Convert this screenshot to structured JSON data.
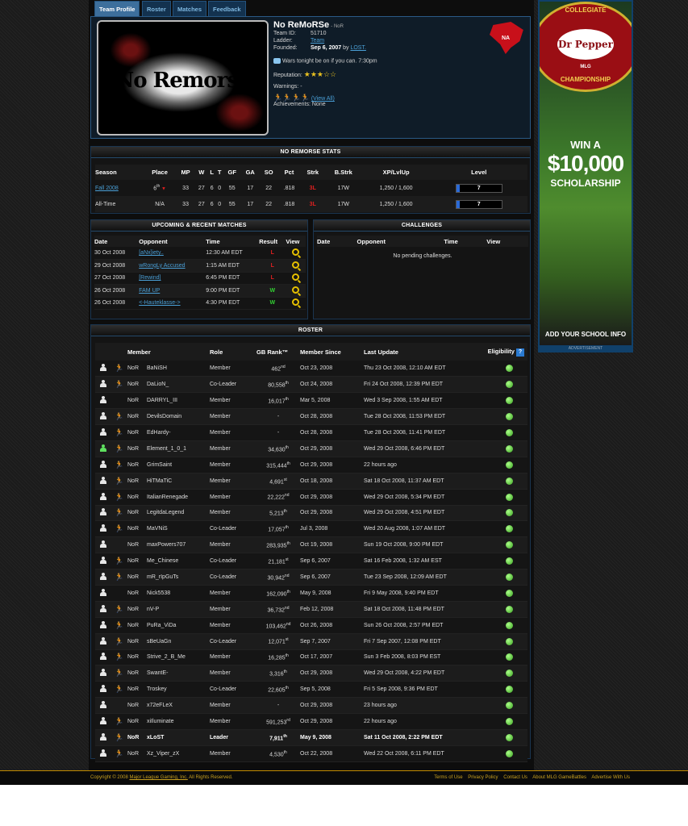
{
  "tabs": {
    "team_profile": "Team Profile",
    "roster": "Roster",
    "matches": "Matches",
    "feedback": "Feedback"
  },
  "team": {
    "name": "No ReMoRSe",
    "tag_suffix": "- NoR",
    "logo_text": "No Remorse",
    "team_id_label": "Team ID:",
    "team_id": "51710",
    "ladder_label": "Ladder:",
    "ladder": "Team",
    "founded_label": "Founded:",
    "founded": "Sep 6, 2007",
    "founded_by": "by",
    "founder": "LOST.",
    "message": "Wars tonight be on if you can. 7:30pm",
    "reputation_label": "Reputation:",
    "reputation_stars": 3.5,
    "warnings_label": "Warnings:",
    "warnings": "-",
    "view_all": "(View All)",
    "achievements_label": "Achievements:",
    "achievements": "None",
    "region": "NA"
  },
  "stats": {
    "title": "NO REMORSE STATS",
    "headers": [
      "Season",
      "Place",
      "MP",
      "W",
      "L",
      "T",
      "GF",
      "GA",
      "SO",
      "Pct",
      "Strk",
      "B.Strk",
      "XP/LvlUp",
      "Level"
    ],
    "rows": [
      {
        "season": "Fall 2008",
        "place": "6",
        "place_sup": "th",
        "mp": "33",
        "w": "27",
        "l": "6",
        "t": "0",
        "gf": "55",
        "ga": "17",
        "so": "22",
        "pct": ".818",
        "strk": "3L",
        "bstrk": "17W",
        "xp": "1,250 / 1,600",
        "level": "7",
        "level_fraction": 0.08
      },
      {
        "season": "All-Time",
        "place": "N/A",
        "place_sup": "",
        "mp": "33",
        "w": "27",
        "l": "6",
        "t": "0",
        "gf": "55",
        "ga": "17",
        "so": "22",
        "pct": ".818",
        "strk": "3L",
        "bstrk": "17W",
        "xp": "1,250 / 1,600",
        "level": "7",
        "level_fraction": 0.08
      }
    ]
  },
  "matches": {
    "title": "UPCOMING & RECENT MATCHES",
    "headers": [
      "Date",
      "Opponent",
      "Time",
      "Result",
      "View"
    ],
    "rows": [
      {
        "date": "30 Oct 2008",
        "opponent": "[aNx]iety..",
        "time": "12:30 AM EDT",
        "result": "L"
      },
      {
        "date": "29 Oct 2008",
        "opponent": "wRongLy Accused",
        "time": "1:15 AM EDT",
        "result": "L"
      },
      {
        "date": "27 Oct 2008",
        "opponent": "[Rewind]",
        "time": "6:45 PM EDT",
        "result": "L"
      },
      {
        "date": "26 Oct 2008",
        "opponent": "FAM UP",
        "time": "9:00 PM EDT",
        "result": "W"
      },
      {
        "date": "26 Oct 2008",
        "opponent": "<-Hauteklasse->",
        "time": "4:30 PM EDT",
        "result": "W"
      }
    ]
  },
  "challenges": {
    "title": "CHALLENGES",
    "headers": [
      "Date",
      "Opponent",
      "Time",
      "View"
    ],
    "empty": "No pending challenges."
  },
  "roster": {
    "title": "ROSTER",
    "headers": {
      "member": "Member",
      "role": "Role",
      "rank": "GB Rank™",
      "since": "Member Since",
      "update": "Last Update",
      "elig": "Eligibility",
      "help": "?"
    },
    "rows": [
      {
        "tag": "NoR",
        "name": "BaNiSH",
        "role": "Member",
        "rank": "462",
        "sup": "nd",
        "since": "Oct 23, 2008",
        "update": "Thu 23 Oct 2008, 12:10 AM EDT",
        "runner": "on",
        "online": false
      },
      {
        "tag": "NoR",
        "name": "DaLioN_",
        "role": "Co-Leader",
        "rank": "80,558",
        "sup": "th",
        "since": "Oct 24, 2008",
        "update": "Fri 24 Oct 2008, 12:39 PM EDT",
        "runner": "dim",
        "online": false
      },
      {
        "tag": "NoR",
        "name": "DARRYL_III",
        "role": "Member",
        "rank": "16,017",
        "sup": "th",
        "since": "Mar 5, 2008",
        "update": "Wed 3 Sep 2008, 1:55 AM EDT",
        "runner": "none",
        "online": false
      },
      {
        "tag": "NoR",
        "name": "DevilsDomain",
        "role": "Member",
        "rank": "-",
        "sup": "",
        "since": "Oct 28, 2008",
        "update": "Tue 28 Oct 2008, 11:53 PM EDT",
        "runner": "on",
        "online": false
      },
      {
        "tag": "NoR",
        "name": "EdHardy-",
        "role": "Member",
        "rank": "-",
        "sup": "",
        "since": "Oct 28, 2008",
        "update": "Tue 28 Oct 2008, 11:41 PM EDT",
        "runner": "dim",
        "online": false
      },
      {
        "tag": "NoR",
        "name": "Element_1_0_1",
        "role": "Member",
        "rank": "34,630",
        "sup": "th",
        "since": "Oct 29, 2008",
        "update": "Wed 29 Oct 2008, 6:46 PM EDT",
        "runner": "on",
        "online": true
      },
      {
        "tag": "NoR",
        "name": "GrimSaint",
        "role": "Member",
        "rank": "315,444",
        "sup": "th",
        "since": "Oct 29, 2008",
        "update": "22 hours ago",
        "runner": "on",
        "online": false
      },
      {
        "tag": "NoR",
        "name": "HiTMaTiC",
        "role": "Member",
        "rank": "4,691",
        "sup": "st",
        "since": "Oct 18, 2008",
        "update": "Sat 18 Oct 2008, 11:37 AM EDT",
        "runner": "on",
        "online": false
      },
      {
        "tag": "NoR",
        "name": "ItalianRenegade",
        "role": "Member",
        "rank": "22,222",
        "sup": "nd",
        "since": "Oct 29, 2008",
        "update": "Wed 29 Oct 2008, 5:34 PM EDT",
        "runner": "dim",
        "online": false
      },
      {
        "tag": "NoR",
        "name": "LegitdaLegend",
        "role": "Member",
        "rank": "5,213",
        "sup": "th",
        "since": "Oct 29, 2008",
        "update": "Wed 29 Oct 2008, 4:51 PM EDT",
        "runner": "dim",
        "online": false
      },
      {
        "tag": "NoR",
        "name": "MaVNiS",
        "role": "Co-Leader",
        "rank": "17,057",
        "sup": "th",
        "since": "Jul 3, 2008",
        "update": "Wed 20 Aug 2008, 1:07 AM EDT",
        "runner": "dim",
        "online": false
      },
      {
        "tag": "NoR",
        "name": "maxPowers707",
        "role": "Member",
        "rank": "283,935",
        "sup": "th",
        "since": "Oct 19, 2008",
        "update": "Sun 19 Oct 2008, 9:00 PM EDT",
        "runner": "none",
        "online": false
      },
      {
        "tag": "NoR",
        "name": "Me_Chinese",
        "role": "Co-Leader",
        "rank": "21,181",
        "sup": "st",
        "since": "Sep 6, 2007",
        "update": "Sat 16 Feb 2008, 1:32 AM EST",
        "runner": "dim",
        "online": false
      },
      {
        "tag": "NoR",
        "name": "mR_rIpGuTs",
        "role": "Co-Leader",
        "rank": "30,942",
        "sup": "nd",
        "since": "Sep 6, 2007",
        "update": "Tue 23 Sep 2008, 12:09 AM EDT",
        "runner": "on",
        "online": false
      },
      {
        "tag": "NoR",
        "name": "Nick5538",
        "role": "Member",
        "rank": "162,090",
        "sup": "th",
        "since": "May 9, 2008",
        "update": "Fri 9 May 2008, 9:40 PM EDT",
        "runner": "none",
        "online": false
      },
      {
        "tag": "NoR",
        "name": "nV-P",
        "role": "Member",
        "rank": "36,732",
        "sup": "nd",
        "since": "Feb 12, 2008",
        "update": "Sat 18 Oct 2008, 11:48 PM EDT",
        "runner": "dim",
        "online": false
      },
      {
        "tag": "NoR",
        "name": "PuRa_ViDa",
        "role": "Member",
        "rank": "103,462",
        "sup": "nd",
        "since": "Oct 26, 2008",
        "update": "Sun 26 Oct 2008, 2:57 PM EDT",
        "runner": "dim",
        "online": false
      },
      {
        "tag": "NoR",
        "name": "sBeUaGn",
        "role": "Co-Leader",
        "rank": "12,071",
        "sup": "st",
        "since": "Sep 7, 2007",
        "update": "Fri 7 Sep 2007, 12:08 PM EDT",
        "runner": "dim",
        "online": false
      },
      {
        "tag": "NoR",
        "name": "Strive_2_B_Me",
        "role": "Member",
        "rank": "16,285",
        "sup": "th",
        "since": "Oct 17, 2007",
        "update": "Sun 3 Feb 2008, 8:03 PM EST",
        "runner": "dim",
        "online": false
      },
      {
        "tag": "NoR",
        "name": "SwantE-",
        "role": "Member",
        "rank": "3,316",
        "sup": "th",
        "since": "Oct 29, 2008",
        "update": "Wed 29 Oct 2008, 4:22 PM EDT",
        "runner": "on",
        "online": false
      },
      {
        "tag": "NoR",
        "name": "Troskey",
        "role": "Co-Leader",
        "rank": "22,605",
        "sup": "th",
        "since": "Sep 5, 2008",
        "update": "Fri 5 Sep 2008, 9:36 PM EDT",
        "runner": "on",
        "online": false
      },
      {
        "tag": "NoR",
        "name": "x72eFLeX",
        "role": "Member",
        "rank": "-",
        "sup": "",
        "since": "Oct 29, 2008",
        "update": "23 hours ago",
        "runner": "none",
        "online": false
      },
      {
        "tag": "NoR",
        "name": "xiIluminate",
        "role": "Member",
        "rank": "591,253",
        "sup": "rd",
        "since": "Oct 29, 2008",
        "update": "22 hours ago",
        "runner": "dim",
        "online": false
      },
      {
        "tag": "NoR",
        "name": "xLoST",
        "role": "Leader",
        "rank": "7,911",
        "sup": "th",
        "since": "May 9, 2008",
        "update": "Sat 11 Oct 2008, 2:22 PM EDT",
        "runner": "dim",
        "online": false,
        "bold": true
      },
      {
        "tag": "NoR",
        "name": "Xz_Viper_zX",
        "role": "Member",
        "rank": "4,530",
        "sup": "th",
        "since": "Oct 22, 2008",
        "update": "Wed 22 Oct 2008, 6:11 PM EDT",
        "runner": "dim",
        "online": false
      }
    ]
  },
  "ad": {
    "brand": "Dr Pepper",
    "ring_top": "COLLEGIATE",
    "ring_bottom": "CHAMPIONSHIP",
    "mlg": "MLG",
    "win": "WIN A",
    "amount": "$10,000",
    "scholarship": "SCHOLARSHIP",
    "cta": "ADD YOUR SCHOOL INFO",
    "label": "ADVERTISEMENT"
  },
  "footer": {
    "copyright": "Copyright © 2008",
    "company": "Major League Gaming, Inc.",
    "rights": "All Rights Reserved.",
    "links": [
      "Terms of Use",
      "Privacy Policy",
      "Contact Us",
      "About MLG GameBattles",
      "Advertise With Us"
    ]
  },
  "colors": {
    "accent": "#4a9fd6",
    "border": "#1a3550",
    "footer_bg": "#0a0a0a",
    "footer_border": "#c08a00",
    "win": "#32d032",
    "loss": "#e02020"
  }
}
